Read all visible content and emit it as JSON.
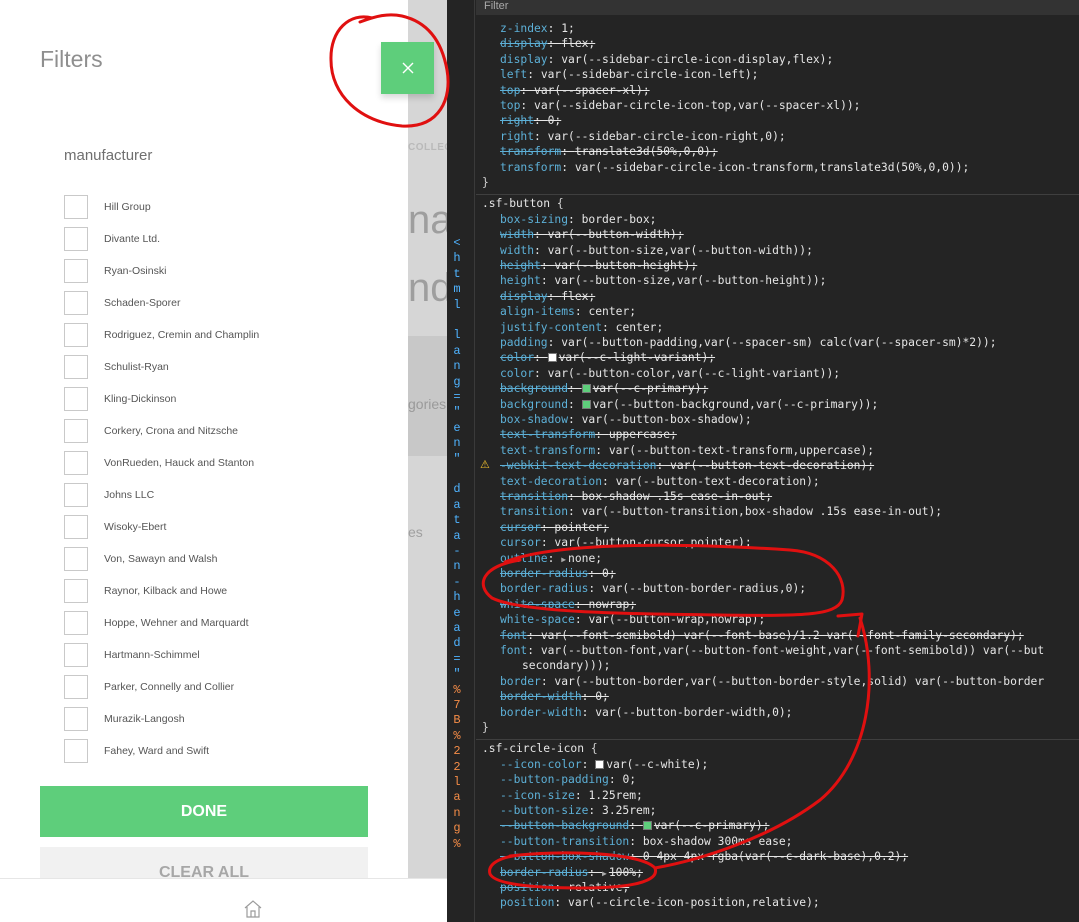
{
  "app": {
    "sidebar": {
      "title": "Filters",
      "section_title": "manufacturer",
      "manufacturers": [
        "Hill Group",
        "Divante Ltd.",
        "Ryan-Osinski",
        "Schaden-Sporer",
        "Rodriguez, Cremin and Champlin",
        "Schulist-Ryan",
        "Kling-Dickinson",
        "Corkery, Crona and Nitzsche",
        "VonRueden, Hauck and Stanton",
        "Johns LLC",
        "Wisoky-Ebert",
        "Von, Sawayn and Walsh",
        "Raynor, Kilback and Howe",
        "Hoppe, Wehner and Marquardt",
        "Hartmann-Schimmel",
        "Parker, Connelly and Collier",
        "Murazik-Langosh",
        "Fahey, Ward and Swift"
      ],
      "done_label": "DONE",
      "clear_label": "CLEAR ALL",
      "close_icon": "close-icon"
    },
    "background_page": {
      "collect_text": "COLLECT",
      "big_text_1": "nar",
      "big_text_2": "nd",
      "categories_text": "gories",
      "es_text": "es"
    },
    "bottom_nav": {
      "home_icon": "home-icon"
    },
    "accent_color": "#5ece7b"
  },
  "devtools": {
    "filter_label": "Filter",
    "dom_gutter": [
      "<",
      "h",
      "t",
      "m",
      "l",
      "",
      "l",
      "a",
      "n",
      "g",
      "=",
      "\"",
      "e",
      "n",
      "\"",
      "",
      "d",
      "a",
      "t",
      "a",
      "-",
      "n",
      "-",
      "h",
      "e",
      "a",
      "d",
      "=",
      "\"",
      "%",
      "7",
      "B",
      "%",
      "2",
      "2",
      "l",
      "a",
      "n",
      "g",
      "%"
    ],
    "rules": [
      {
        "lines": [
          {
            "prop": "z-index",
            "val": "1;"
          },
          {
            "prop": "display",
            "val": "flex;",
            "struck": true
          },
          {
            "prop": "display",
            "val": "var(--sidebar-circle-icon-display,flex);"
          },
          {
            "prop": "left",
            "val": "var(--sidebar-circle-icon-left);"
          },
          {
            "prop": "top",
            "val": "var(--spacer-xl);",
            "struck": true
          },
          {
            "prop": "top",
            "val": "var(--sidebar-circle-icon-top,var(--spacer-xl));"
          },
          {
            "prop": "right",
            "val": "0;",
            "struck": true
          },
          {
            "prop": "right",
            "val": "var(--sidebar-circle-icon-right,0);"
          },
          {
            "prop": "transform",
            "val": "translate3d(50%,0,0);",
            "struck": true
          },
          {
            "prop": "transform",
            "val": "var(--sidebar-circle-icon-transform,translate3d(50%,0,0));"
          }
        ]
      },
      {
        "selector": ".sf-button",
        "lines": [
          {
            "prop": "box-sizing",
            "val": "border-box;"
          },
          {
            "prop": "width",
            "val": "var(--button-width);",
            "struck": true
          },
          {
            "prop": "width",
            "val": "var(--button-size,var(--button-width));"
          },
          {
            "prop": "height",
            "val": "var(--button-height);",
            "struck": true
          },
          {
            "prop": "height",
            "val": "var(--button-size,var(--button-height));"
          },
          {
            "prop": "display",
            "val": "flex;",
            "struck": true
          },
          {
            "prop": "align-items",
            "val": "center;"
          },
          {
            "prop": "justify-content",
            "val": "center;"
          },
          {
            "prop": "padding",
            "val": "var(--button-padding,var(--spacer-sm) calc(var(--spacer-sm)*2));"
          },
          {
            "prop": "color",
            "val": "var(--c-light-variant);",
            "struck": true,
            "swatch": "white"
          },
          {
            "prop": "color",
            "val": "var(--button-color,var(--c-light-variant));"
          },
          {
            "prop": "background",
            "val": "var(--c-primary);",
            "struck": true,
            "swatch": "green"
          },
          {
            "prop": "background",
            "val": "var(--button-background,var(--c-primary));",
            "swatch": "green"
          },
          {
            "prop": "box-shadow",
            "val": "var(--button-box-shadow);"
          },
          {
            "prop": "text-transform",
            "val": "uppercase;",
            "struck": true
          },
          {
            "prop": "text-transform",
            "val": "var(--button-text-transform,uppercase);"
          },
          {
            "prop": "-webkit-text-decoration",
            "val": "var(--button-text-decoration);",
            "struck": true,
            "warn": true
          },
          {
            "prop": "text-decoration",
            "val": "var(--button-text-decoration);"
          },
          {
            "prop": "transition",
            "val": "box-shadow .15s ease-in-out;",
            "struck": true,
            "swatch_ease": true
          },
          {
            "prop": "transition",
            "val": "var(--button-transition,box-shadow .15s ease-in-out);"
          },
          {
            "prop": "cursor",
            "val": "pointer;",
            "struck": true
          },
          {
            "prop": "cursor",
            "val": "var(--button-cursor,pointer);"
          },
          {
            "prop": "outline",
            "val": "none;",
            "triangle": true
          },
          {
            "prop": "border-radius",
            "val": "0;",
            "struck": true
          },
          {
            "prop": "border-radius",
            "val": "var(--button-border-radius,0);"
          },
          {
            "prop": "white-space",
            "val": "nowrap;",
            "struck": true
          },
          {
            "prop": "white-space",
            "val": "var(--button-wrap,nowrap);"
          },
          {
            "prop": "font",
            "val": "var(--font-semibold) var(--font-base)/1.2 var(--font-family-secondary);",
            "struck": true
          },
          {
            "prop": "font",
            "val": "var(--button-font,var(--button-font-weight,var(--font-semibold)) var(--but"
          },
          {
            "cont": "secondary)));"
          },
          {
            "prop": "border",
            "val": "var(--button-border,var(--button-border-style,solid) var(--button-border"
          },
          {
            "prop": "border-width",
            "val": "0;",
            "struck": true
          },
          {
            "prop": "border-width",
            "val": "var(--button-border-width,0);"
          }
        ]
      },
      {
        "selector": ".sf-circle-icon",
        "lines": [
          {
            "prop": "--icon-color",
            "val": "var(--c-white);",
            "swatch": "white"
          },
          {
            "prop": "--button-padding",
            "val": "0;"
          },
          {
            "prop": "--icon-size",
            "val": "1.25rem;"
          },
          {
            "prop": "--button-size",
            "val": "3.25rem;"
          },
          {
            "prop": "--button-background",
            "val": "var(--c-primary);",
            "struck": true,
            "swatch": "green"
          },
          {
            "prop": "--button-transition",
            "val": "box-shadow 300ms ease;",
            "swatch_ease_mid": true
          },
          {
            "prop": "--button-box-shadow",
            "val": "0 4px 4px rgba(var(--c-dark-base),0.2);",
            "struck": true
          },
          {
            "prop": "border-radius",
            "val": "100%;",
            "struck": true,
            "triangle": true
          },
          {
            "prop": "position",
            "val": "relative;",
            "struck": true
          },
          {
            "prop": "position",
            "val": "var(--circle-icon-position,relative);"
          }
        ]
      }
    ]
  },
  "annotation_color": "#e01010"
}
